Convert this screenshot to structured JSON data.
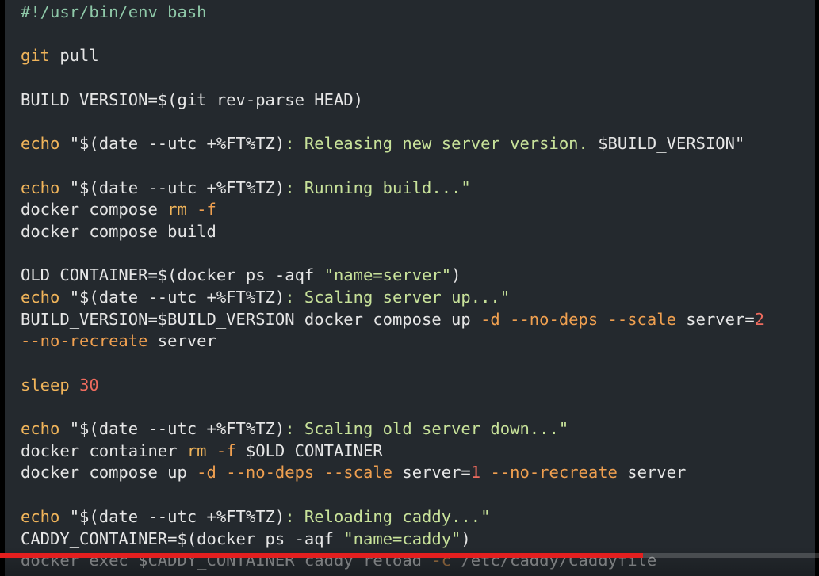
{
  "script": {
    "lines": [
      {
        "tokens": [
          {
            "t": "#!/usr/bin/env bash",
            "k": "comment"
          }
        ]
      },
      {
        "tokens": []
      },
      {
        "tokens": [
          {
            "t": "git",
            "k": "cmd"
          },
          {
            "t": " pull",
            "k": "plain"
          }
        ]
      },
      {
        "tokens": []
      },
      {
        "tokens": [
          {
            "t": "BUILD_VERSION=$(git rev-parse HEAD)",
            "k": "plain"
          }
        ]
      },
      {
        "tokens": []
      },
      {
        "tokens": [
          {
            "t": "echo",
            "k": "cmd"
          },
          {
            "t": " \"$(date --utc +%FT%TZ)",
            "k": "plain"
          },
          {
            "t": ": Releasing new server version. ",
            "k": "str"
          },
          {
            "t": "$BUILD_VERSION\"",
            "k": "plain"
          }
        ]
      },
      {
        "tokens": []
      },
      {
        "tokens": [
          {
            "t": "echo",
            "k": "cmd"
          },
          {
            "t": " \"$(date --utc +%FT%TZ)",
            "k": "plain"
          },
          {
            "t": ": Running build...\"",
            "k": "str"
          }
        ]
      },
      {
        "tokens": [
          {
            "t": "docker compose ",
            "k": "plain"
          },
          {
            "t": "rm",
            "k": "cmd"
          },
          {
            "t": " ",
            "k": "plain"
          },
          {
            "t": "-f",
            "k": "flag"
          }
        ]
      },
      {
        "tokens": [
          {
            "t": "docker compose build",
            "k": "plain"
          }
        ]
      },
      {
        "tokens": []
      },
      {
        "tokens": [
          {
            "t": "OLD_CONTAINER=$(docker ps -aqf ",
            "k": "plain"
          },
          {
            "t": "\"name=server\"",
            "k": "str"
          },
          {
            "t": ")",
            "k": "plain"
          }
        ]
      },
      {
        "tokens": [
          {
            "t": "echo",
            "k": "cmd"
          },
          {
            "t": " \"$(date --utc +%FT%TZ)",
            "k": "plain"
          },
          {
            "t": ": Scaling server up...\"",
            "k": "str"
          }
        ]
      },
      {
        "tokens": [
          {
            "t": "BUILD_VERSION=$BUILD_VERSION docker compose up ",
            "k": "plain"
          },
          {
            "t": "-d --no-deps --scale",
            "k": "flag"
          },
          {
            "t": " server=",
            "k": "plain"
          },
          {
            "t": "2",
            "k": "num"
          }
        ]
      },
      {
        "tokens": [
          {
            "t": "--no-recreate",
            "k": "flag"
          },
          {
            "t": " server",
            "k": "plain"
          }
        ]
      },
      {
        "tokens": []
      },
      {
        "tokens": [
          {
            "t": "sleep",
            "k": "cmd"
          },
          {
            "t": " ",
            "k": "plain"
          },
          {
            "t": "30",
            "k": "num"
          }
        ]
      },
      {
        "tokens": []
      },
      {
        "tokens": [
          {
            "t": "echo",
            "k": "cmd"
          },
          {
            "t": " \"$(date --utc +%FT%TZ)",
            "k": "plain"
          },
          {
            "t": ": Scaling old server down...\"",
            "k": "str"
          }
        ]
      },
      {
        "tokens": [
          {
            "t": "docker container ",
            "k": "plain"
          },
          {
            "t": "rm",
            "k": "cmd"
          },
          {
            "t": " ",
            "k": "plain"
          },
          {
            "t": "-f",
            "k": "flag"
          },
          {
            "t": " $OLD_CONTAINER",
            "k": "plain"
          }
        ]
      },
      {
        "tokens": [
          {
            "t": "docker compose up ",
            "k": "plain"
          },
          {
            "t": "-d --no-deps --scale",
            "k": "flag"
          },
          {
            "t": " server=",
            "k": "plain"
          },
          {
            "t": "1",
            "k": "num"
          },
          {
            "t": " ",
            "k": "plain"
          },
          {
            "t": "--no-recreate",
            "k": "flag"
          },
          {
            "t": " server",
            "k": "plain"
          }
        ]
      },
      {
        "tokens": []
      },
      {
        "tokens": [
          {
            "t": "echo",
            "k": "cmd"
          },
          {
            "t": " \"$(date --utc +%FT%TZ)",
            "k": "plain"
          },
          {
            "t": ": Reloading caddy...\"",
            "k": "str"
          }
        ]
      },
      {
        "tokens": [
          {
            "t": "CADDY_CONTAINER=$(docker ps -aqf ",
            "k": "plain"
          },
          {
            "t": "\"name=caddy\"",
            "k": "str"
          },
          {
            "t": ")",
            "k": "plain"
          }
        ]
      },
      {
        "tokens": [
          {
            "t": "docker exec $CADDY_CONTAINER caddy reload ",
            "k": "plain"
          },
          {
            "t": "-c",
            "k": "flag"
          },
          {
            "t": " /etc/caddy/Caddyfile",
            "k": "plain"
          }
        ],
        "faded": true
      }
    ]
  },
  "player": {
    "progress_fraction": 0.785
  },
  "colors": {
    "background": "#24292e",
    "comment": "#8fc9a9",
    "command": "#f0b45a",
    "string": "#c8e29a",
    "flag": "#f0a050",
    "number": "#ee6b5e",
    "text": "#e6e6e6",
    "progress": "#e41f1f"
  }
}
